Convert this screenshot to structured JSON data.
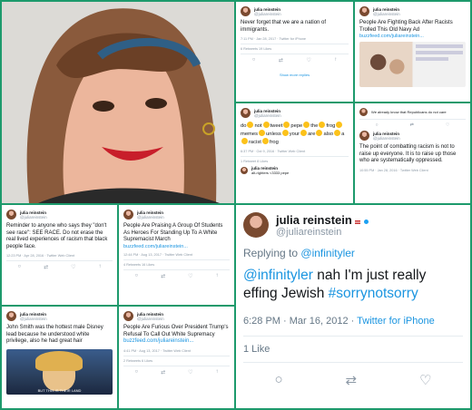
{
  "account": {
    "name": "julia reinstein",
    "handle": "@juliareinstein"
  },
  "tweets": [
    {
      "body": "Never forget that we are a nation of immigrants.",
      "meta": "7:11 PM · Jan 28, 2017 · Twitter for iPhone",
      "stats": "6 Retweets   19 Likes",
      "extra": "Show more replies"
    },
    {
      "body": "People Are Fighting Back After Racists Trolled This Old Navy Ad",
      "link": "buzzfeed.com/juliareinstein...",
      "meta": "12:41 PM · Nov 11, 2016"
    },
    {
      "words": [
        "do",
        "not",
        "tweet",
        "pepe",
        "the",
        "frog",
        "memes",
        "unless",
        "your",
        "are",
        "also",
        "a",
        "racist",
        "frog"
      ],
      "meta": "6:37 PM · Oct 9, 2016 · Twitter Web Client",
      "stats": "1 Retweet   8 Likes",
      "reply_name": "julia reinstein",
      "reply_body": "alt-righters <3333 pepe"
    },
    {
      "body": "We already know that Republicans do not care",
      "body2": "The point of combatting racism is not to raise up everyone. It is to raise up those who are systematically oppressed.",
      "meta": "10:55 PM · Jan 28, 2016 · Twitter Web Client"
    },
    {
      "body": "Reminder to anyone who says they \"don't see race\": SEE RACE. Do not erase the real lived experiences of racism that black people face.",
      "meta": "12:23 PM · Apr 28, 2016 · Twitter Web Client"
    },
    {
      "body": "People Are Praising A Group Of Students As Heroes For Standing Up To A White Supremacist March",
      "link": "buzzfeed.com/juliareinstein...",
      "meta": "12:44 PM · Aug 13, 2017 · Twitter Web Client",
      "stats": "4 Retweets   16 Likes"
    },
    {
      "body": "John Smith was the hottest male Disney lead because he understood white privilege, also he had great hair",
      "caption": "BUT THIS IS THEIR LAND"
    },
    {
      "body": "People Are Furious Over President Trump's Refusal To Call Out White Supremacy",
      "link": "buzzfeed.com/juliareinstein...",
      "meta": "4:41 PM · Aug 13, 2017 · Twitter Web Client",
      "stats": "2 Retweets   6 Likes"
    }
  ],
  "big": {
    "name": "julia reinstein",
    "handle": "@juliareinstein",
    "reply_prefix": "Replying to",
    "reply_to": "@infinityler",
    "mention": "@infinityler",
    "text": " nah I'm just really effing Jewish ",
    "hashtag": "#sorrynotsorry",
    "time": "6:28 PM · Mar 16, 2012 · ",
    "client": "Twitter for iPhone",
    "likes": "1 Like"
  },
  "colors": {
    "border": "#1d9a6c",
    "link": "#1b95e0"
  }
}
